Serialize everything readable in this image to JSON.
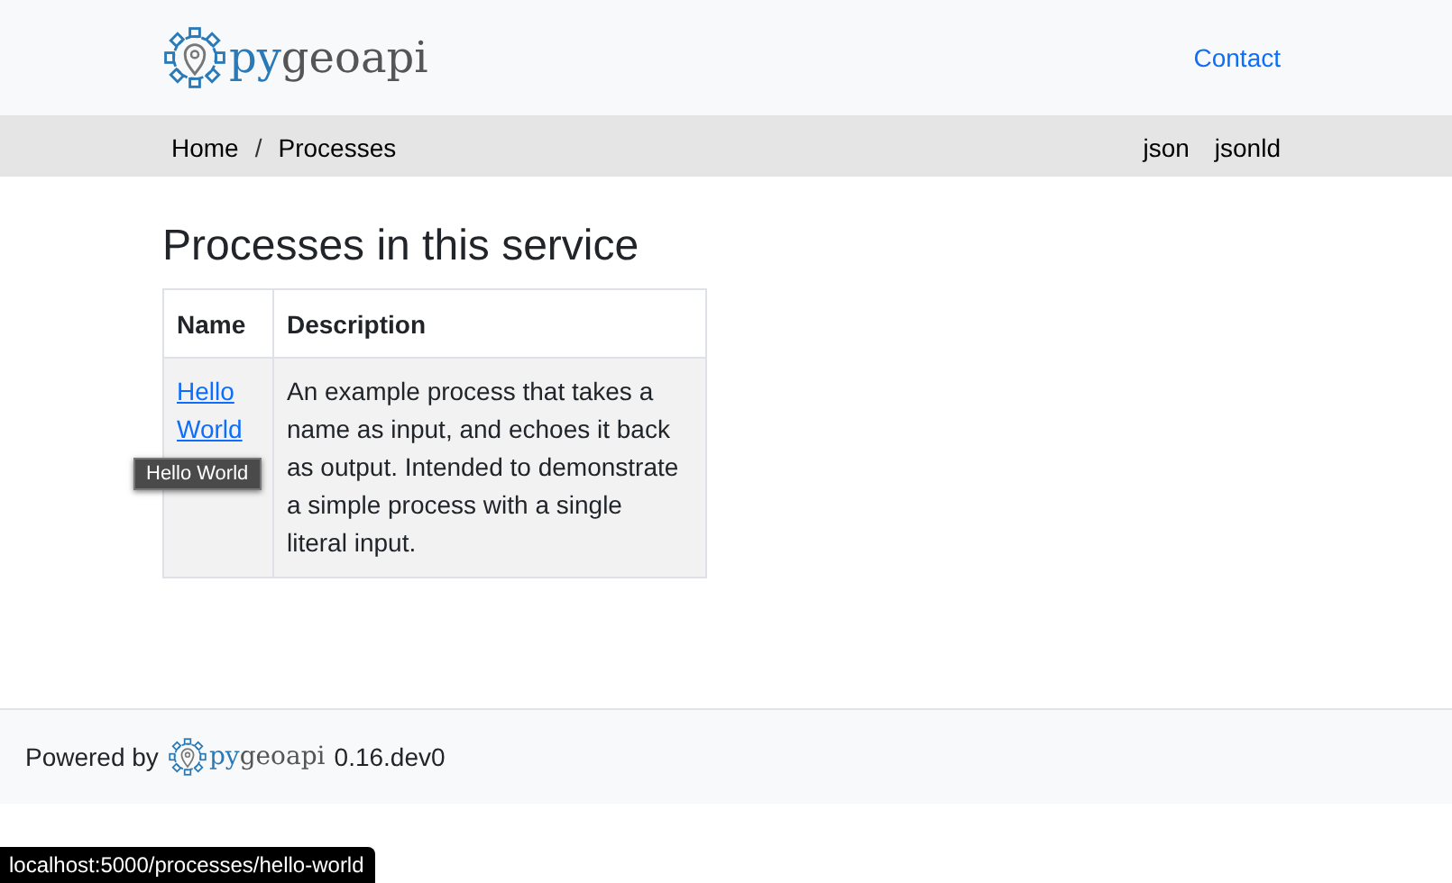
{
  "header": {
    "logo": {
      "accent": "py",
      "rest": "geoapi"
    },
    "nav": [
      {
        "label": "Contact"
      }
    ]
  },
  "breadcrumb": {
    "items": [
      {
        "label": "Home"
      },
      {
        "label": "Processes"
      }
    ],
    "separator": "/",
    "formats": [
      {
        "label": "json"
      },
      {
        "label": "jsonld"
      }
    ]
  },
  "main": {
    "title": "Processes in this service",
    "table": {
      "columns": [
        "Name",
        "Description"
      ],
      "rows": [
        {
          "name": "Hello World",
          "description": "An example process that takes a name as input, and echoes it back as output. Intended to demonstrate a simple process with a single literal input."
        }
      ]
    },
    "tooltip": "Hello World"
  },
  "footer": {
    "prefix": "Powered by",
    "logo": {
      "accent": "py",
      "rest": "geoapi"
    },
    "version": "0.16.dev0"
  },
  "status_bar": "localhost:5000/processes/hello-world"
}
